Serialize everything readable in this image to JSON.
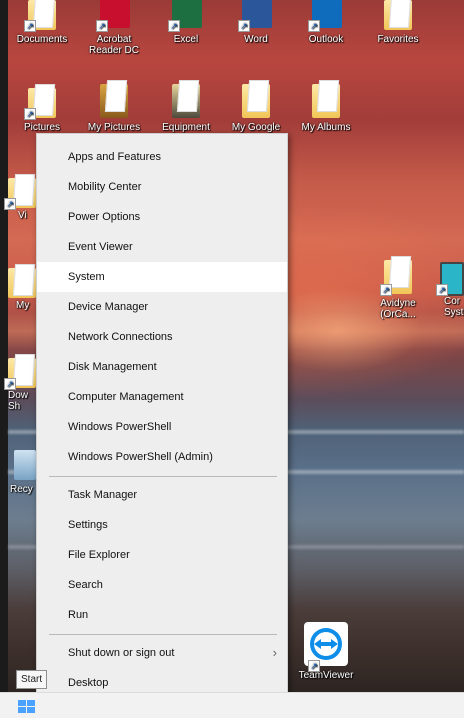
{
  "desktop": {
    "top_row": [
      {
        "label": "Documents",
        "icon": "folder-icon"
      },
      {
        "label": "Acrobat\nReader DC",
        "icon": "acrobat-icon",
        "color": "#c8102e"
      },
      {
        "label": "Excel",
        "icon": "excel-icon",
        "color": "#1d6f42"
      },
      {
        "label": "Word",
        "icon": "word-icon",
        "color": "#2b579a"
      },
      {
        "label": "Outlook",
        "icon": "outlook-icon",
        "color": "#0f6cbd"
      },
      {
        "label": "Favorites",
        "icon": "folder-icon"
      }
    ],
    "second_row": [
      {
        "label": "Pictures",
        "icon": "pictures-folder-icon"
      },
      {
        "label": "My Pictures",
        "icon": "folder-icon"
      },
      {
        "label": "Equipment",
        "icon": "folder-icon"
      },
      {
        "label": "My Google",
        "icon": "folder-icon"
      },
      {
        "label": "My Albums",
        "icon": "folder-icon"
      }
    ],
    "left_partial": [
      {
        "label": "Vi"
      },
      {
        "label": "My"
      },
      {
        "label": "Dow\nSh"
      },
      {
        "label": "Recy"
      }
    ],
    "right_icons": [
      {
        "label": "Avidyne\n(OrCa...",
        "icon": "folder-icon"
      },
      {
        "label": "Cor\nSyst",
        "icon": "monitor-icon"
      }
    ],
    "teamviewer": {
      "label": "TeamViewer",
      "icon": "teamviewer-icon",
      "color": "#0e8ee9"
    }
  },
  "menu": {
    "groups": [
      [
        "Apps and Features",
        "Mobility Center",
        "Power Options",
        "Event Viewer",
        "System",
        "Device Manager",
        "Network Connections",
        "Disk Management",
        "Computer Management",
        "Windows PowerShell",
        "Windows PowerShell (Admin)"
      ],
      [
        "Task Manager",
        "Settings",
        "File Explorer",
        "Search",
        "Run"
      ],
      [
        "Shut down or sign out",
        "Desktop"
      ]
    ],
    "highlighted": "System",
    "submenu_indicator": "›"
  },
  "taskbar": {
    "start_tooltip": "Start",
    "start_icon": "windows-logo-icon"
  },
  "colors": {
    "menu_bg": "#eeeeee",
    "menu_hover": "#ffffff",
    "start_blue": "#4aa1ff"
  }
}
